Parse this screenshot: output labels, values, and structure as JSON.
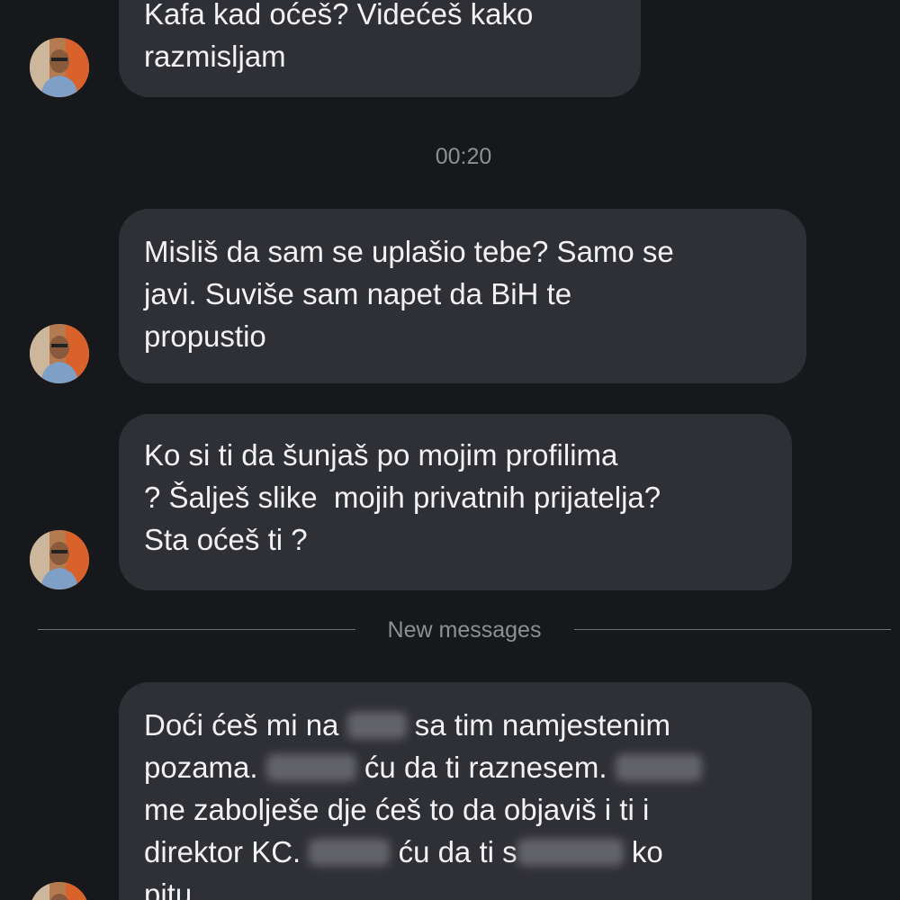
{
  "chat": {
    "timestamp": "00:20",
    "new_messages_label": "New messages",
    "messages": [
      {
        "lines": [
          "Kafa kad oćeš? Videćeš kako",
          "razmisljam"
        ]
      },
      {
        "lines": [
          "Misliš da sam se uplašio tebe? Samo se",
          "javi. Suviše sam napet da BiH te",
          "propustio"
        ]
      },
      {
        "lines": [
          "Ko si ti da šunjaš po mojim profilima",
          "? Šalješ slike  mojih privatnih prijatelja?",
          "Sta oćeš ti ?"
        ]
      },
      {
        "line1_a": "Doći ćeš mi na",
        "line1_b": "sa tim namjestenim",
        "line2_a": "pozama.",
        "line2_b": "ću da ti raznesem.",
        "line3": "me zabolješe dje ćeš to da objaviš i ti i",
        "line4_a": "direktor KC.",
        "line4_b": "ću da ti s",
        "line4_c": "ko",
        "line5": "pitu."
      }
    ]
  }
}
